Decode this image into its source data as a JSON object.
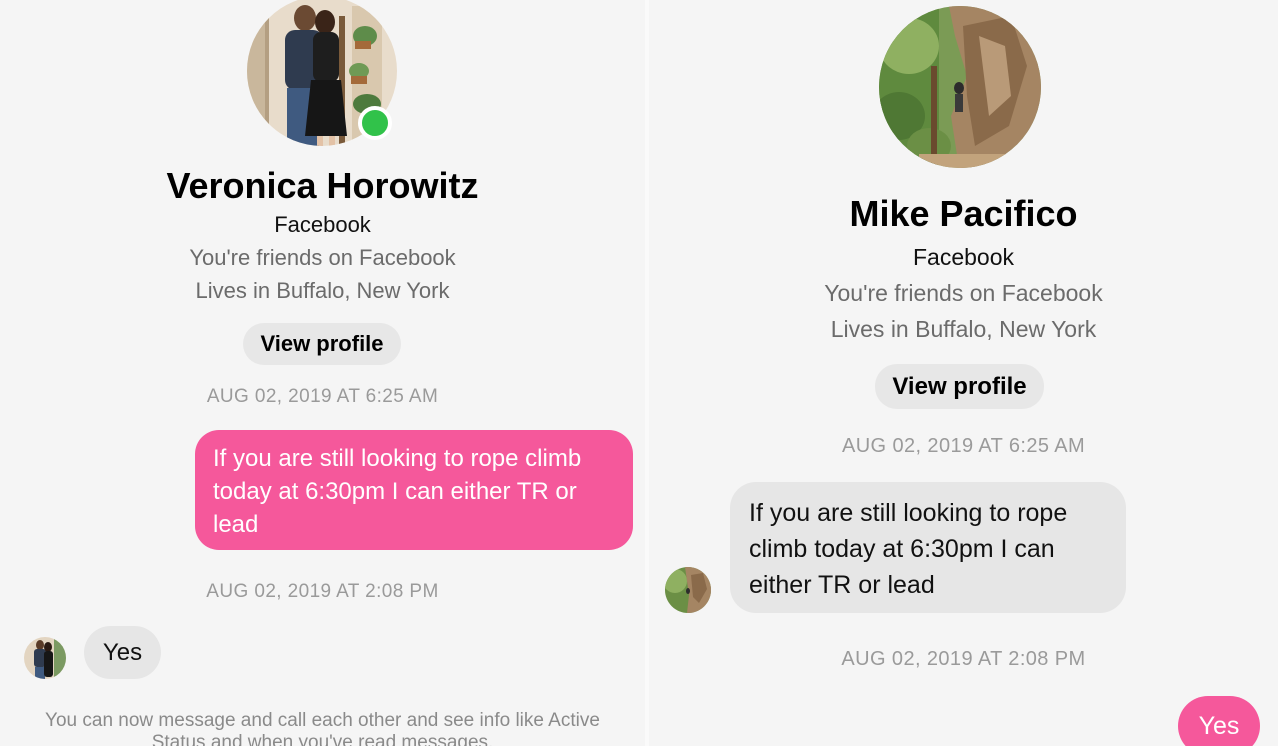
{
  "left": {
    "name": "Veronica Horowitz",
    "platform": "Facebook",
    "friend_status": "You're friends on Facebook",
    "location": "Lives in Buffalo, New York",
    "view_profile_label": "View profile",
    "timestamp_1": "AUG 02, 2019 AT 6:25 AM",
    "message_out": "If you are still looking to rope climb today at 6:30pm I can either TR or lead",
    "timestamp_2": "AUG 02, 2019 AT 2:08 PM",
    "reply": "Yes",
    "footer_note": "You can now message and call each other and see info like Active Status and when you've read messages."
  },
  "right": {
    "name": "Mike Pacifico",
    "platform": "Facebook",
    "friend_status": "You're friends on Facebook",
    "location": "Lives in Buffalo, New York",
    "view_profile_label": "View profile",
    "timestamp_1": "AUG 02, 2019 AT 6:25 AM",
    "message_in": "If you are still looking to rope climb today at 6:30pm I can either TR or lead",
    "timestamp_2": "AUG 02, 2019 AT 2:08 PM",
    "reply": "Yes"
  },
  "colors": {
    "outgoing_bubble": "#f5589b",
    "incoming_bubble": "#e6e6e6",
    "online_indicator": "#31c24a",
    "background": "#f5f5f5"
  }
}
